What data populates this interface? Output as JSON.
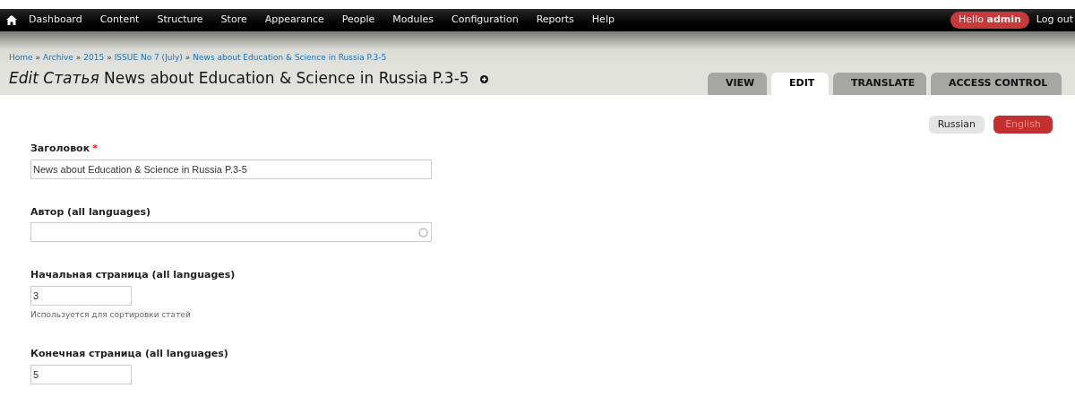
{
  "toolbar": {
    "menu": [
      "Dashboard",
      "Content",
      "Structure",
      "Store",
      "Appearance",
      "People",
      "Modules",
      "Configuration",
      "Reports",
      "Help"
    ],
    "greeting": "Hello **admin**",
    "logout": "Log out"
  },
  "breadcrumb": [
    "Home",
    "Archive",
    "2015",
    "ISSUE No 7 (July)",
    "News about Education & Science in Russia P.3-5"
  ],
  "breadcrumb_separator": "»",
  "page_title": "*Edit Статья* News about Education & Science in Russia P.3-5",
  "tabs": [
    {
      "label": "VIEW",
      "selected": false
    },
    {
      "label": "EDIT",
      "selected": true
    },
    {
      "label": "TRANSLATE",
      "selected": false
    },
    {
      "label": "ACCESS CONTROL",
      "selected": false
    }
  ],
  "languages": [
    {
      "label": "Russian",
      "selected": false
    },
    {
      "label": "English",
      "selected": true
    }
  ],
  "fields": [
    {
      "kind": "text",
      "label": "Заголовок",
      "required_marker": "*",
      "value": "News about Education & Science in Russia P.3-5"
    },
    {
      "kind": "autocomplete",
      "label": "Автор (all languages)"
    },
    {
      "kind": "number",
      "label": "Начальная страница (all languages)",
      "value": "3",
      "description": "Используется для сортировки статей"
    },
    {
      "kind": "number",
      "label": "Конечная страница (all languages)",
      "value": "5"
    }
  ]
}
